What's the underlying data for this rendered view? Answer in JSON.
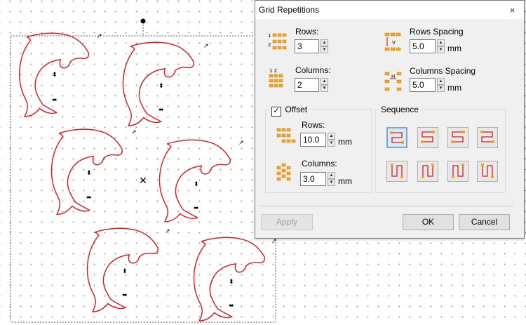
{
  "dialog": {
    "title": "Grid Repetitions",
    "close_glyph": "×",
    "rows": {
      "label": "Rows:",
      "value": "3"
    },
    "columns": {
      "label": "Columns:",
      "value": "2"
    },
    "rows_spacing": {
      "label": "Rows Spacing",
      "value": "5.0",
      "unit": "mm"
    },
    "columns_spacing": {
      "label": "Columns Spacing",
      "value": "5.0",
      "unit": "mm"
    },
    "offset": {
      "label": "Offset",
      "checked": true,
      "rows": {
        "label": "Rows:",
        "value": "10.0",
        "unit": "mm"
      },
      "columns": {
        "label": "Columns:",
        "value": "3.0",
        "unit": "mm"
      }
    },
    "sequence": {
      "label": "Sequence",
      "selected_index": 0,
      "count": 8
    },
    "buttons": {
      "apply": "Apply",
      "ok": "OK",
      "cancel": "Cancel"
    }
  },
  "canvas": {
    "design": "dolphin outline repeated in grid (3 rows × 2 columns)",
    "outline_color": "#e3191d"
  }
}
